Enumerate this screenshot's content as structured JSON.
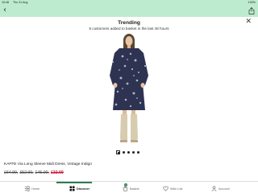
{
  "status_bar": {
    "time": "15:48",
    "date": "Thu 31 Aug",
    "battery": "100%"
  },
  "overlay": {
    "title": "Trending",
    "subtitle": "6 customers added to basket in the last 48 hours"
  },
  "product": {
    "name": "KAFFE Via Long Sleeve Midi Dress, Vintage Indigo",
    "old_prices": [
      "£64.99,",
      "£52.00,",
      "£45.00,"
    ],
    "current_price": "£32.00"
  },
  "carousel": {
    "count": 5,
    "active_index": 0
  },
  "tabs": [
    {
      "label": "Home",
      "icon": "home-icon"
    },
    {
      "label": "Discover",
      "icon": "discover-icon",
      "active": true
    },
    {
      "label": "Basket",
      "icon": "basket-icon",
      "badge": "1"
    },
    {
      "label": "Wish List",
      "icon": "heart-icon"
    },
    {
      "label": "Account",
      "icon": "account-icon"
    }
  ],
  "colors": {
    "header": "#bdebcf",
    "accent": "#2e7d4f",
    "sale": "#c8102e"
  }
}
